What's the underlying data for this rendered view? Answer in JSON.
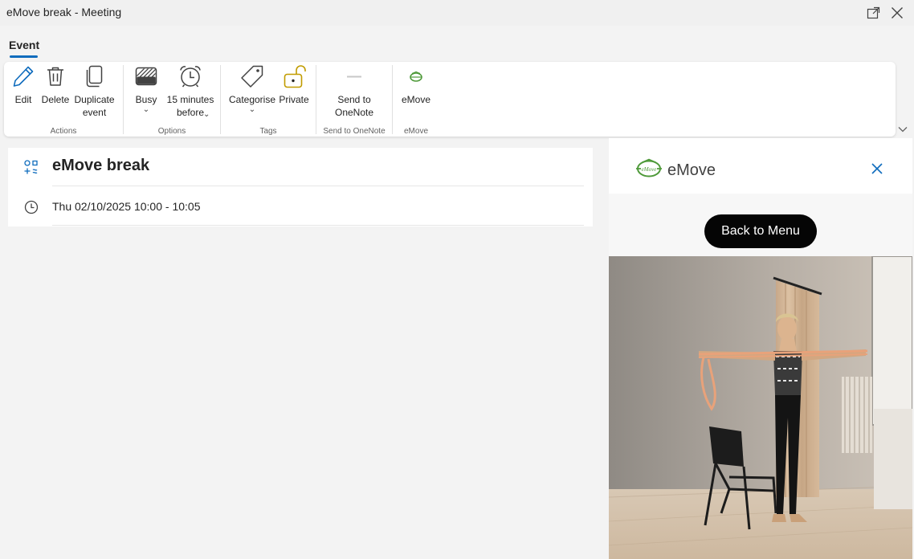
{
  "window": {
    "title": "eMove break - Meeting"
  },
  "tabs": [
    {
      "label": "Event",
      "active": true
    }
  ],
  "ribbon": {
    "groups": [
      {
        "label": "Actions",
        "buttons": [
          {
            "label": "Edit",
            "icon": "pencil-icon"
          },
          {
            "label": "Delete",
            "icon": "trash-icon"
          },
          {
            "label": "Duplicate\nevent",
            "icon": "duplicate-icon"
          }
        ]
      },
      {
        "label": "Options",
        "buttons": [
          {
            "label": "Busy",
            "icon": "busy-status-icon",
            "dropdown": true
          },
          {
            "label": "15 minutes\nbefore",
            "icon": "alarm-clock-icon",
            "dropdown": true
          }
        ]
      },
      {
        "label": "Tags",
        "buttons": [
          {
            "label": "Categorise",
            "icon": "tag-icon",
            "dropdown": true
          },
          {
            "label": "Private",
            "icon": "unlocked-padlock-icon"
          }
        ]
      },
      {
        "label": "Send to OneNote",
        "buttons": [
          {
            "label": "Send to\nOneNote",
            "icon": "onenote-icon"
          }
        ]
      },
      {
        "label": "eMove",
        "buttons": [
          {
            "label": "eMove",
            "icon": "emove-logo-icon"
          }
        ]
      }
    ],
    "chevron": "⌄"
  },
  "event": {
    "title": "eMove break",
    "datetime": "Thu 02/10/2025 10:00 - 10:05"
  },
  "side_panel": {
    "title": "eMove",
    "logo_text": "eMove",
    "back_button": "Back to Menu"
  },
  "colors": {
    "accent": "#0f6cbd",
    "private_icon": "#c19c00",
    "emove_green": "#4f9a3a",
    "button_dark": "#050505"
  }
}
